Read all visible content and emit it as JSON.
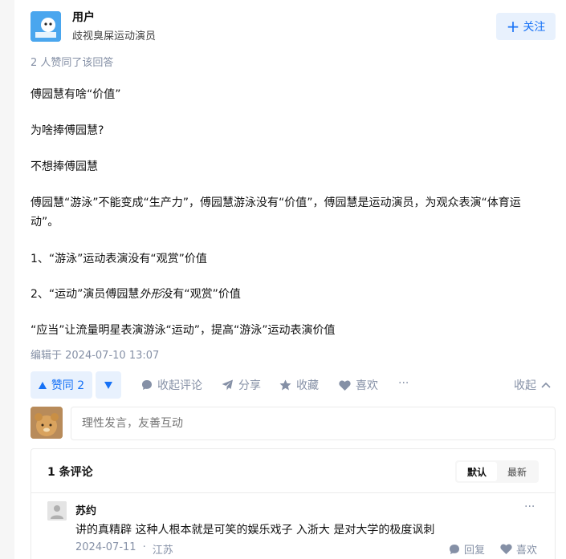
{
  "author": {
    "name": "用户",
    "bio": "歧视臭屎运动演员",
    "follow_label": "关注"
  },
  "votes_note": "2 人赞同了该回答",
  "content": {
    "p1": "傅园慧有啥“价值”",
    "p2": "为啥捧傅园慧?",
    "p3": "不想捧傅园慧",
    "p4": "傅园慧“游泳”不能变成“生产力”，傅园慧游泳没有“价值”，傅园慧是运动演员，为观众表演“体育运动”。",
    "p5": "1、“游泳”运动表演没有“观赏”价值",
    "p6_a": "2、“运动”演员傅园慧",
    "p6_b": "外形",
    "p6_c": "没有“观赏”价值",
    "p7": "“应当”让流量明星表演游泳“运动”，提高“游泳”运动表演价值"
  },
  "edited": "编辑于 2024-07-10 13:07",
  "actions": {
    "vote_up": "赞同 2",
    "collapse_comments": "收起评论",
    "share": "分享",
    "favorite": "收藏",
    "like": "喜欢",
    "more": "···",
    "collapse": "收起"
  },
  "comment_input": {
    "placeholder": "理性发言，友善互动"
  },
  "comments": {
    "count_label": "1 条评论",
    "sort_default": "默认",
    "sort_latest": "最新",
    "items": [
      {
        "author": "苏约",
        "text": "讲的真精辟 这种人根本就是可笑的娱乐戏子 入浙大 是对大学的极度讽刺",
        "date": "2024-07-11",
        "sep": "·",
        "location": "江苏",
        "reply": "回复",
        "like": "喜欢",
        "more": "···"
      }
    ]
  },
  "colors": {
    "accent": "#1772f6",
    "accent_bg": "#e8f1fd",
    "muted": "#8590a6"
  }
}
